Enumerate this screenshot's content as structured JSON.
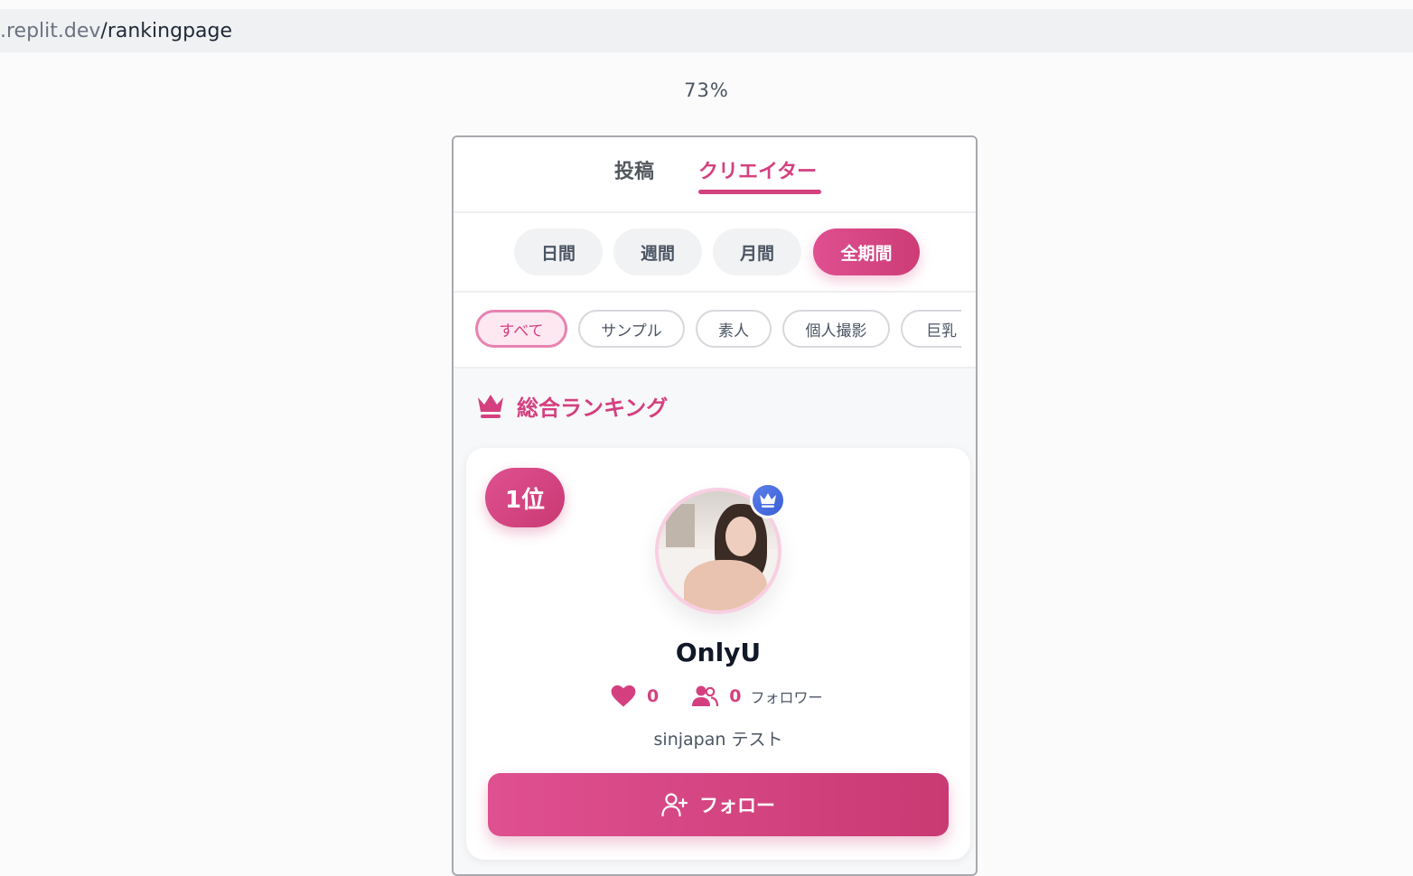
{
  "browser": {
    "url_host": ".replit.dev",
    "url_path": "/rankingpage"
  },
  "zoom_label": "73%",
  "tabs": [
    {
      "label": "投稿",
      "active": false
    },
    {
      "label": "クリエイター",
      "active": true
    }
  ],
  "periods": [
    {
      "label": "日間",
      "active": false
    },
    {
      "label": "週間",
      "active": false
    },
    {
      "label": "月間",
      "active": false
    },
    {
      "label": "全期間",
      "active": true
    }
  ],
  "categories": [
    {
      "label": "すべて",
      "active": true
    },
    {
      "label": "サンプル",
      "active": false
    },
    {
      "label": "素人",
      "active": false
    },
    {
      "label": "個人撮影",
      "active": false
    },
    {
      "label": "巨乳",
      "active": false
    }
  ],
  "section": {
    "title": "総合ランキング",
    "icon": "crown-icon"
  },
  "creator": {
    "rank_label": "1位",
    "name": "OnlyU",
    "likes": "0",
    "followers": "0",
    "followers_label": "フォロワー",
    "description": "sinjapan テスト",
    "follow_label": "フォロー",
    "badge_icon": "crown-icon"
  },
  "colors": {
    "accent": "#d4407f",
    "badge": "#4a6fe0"
  }
}
